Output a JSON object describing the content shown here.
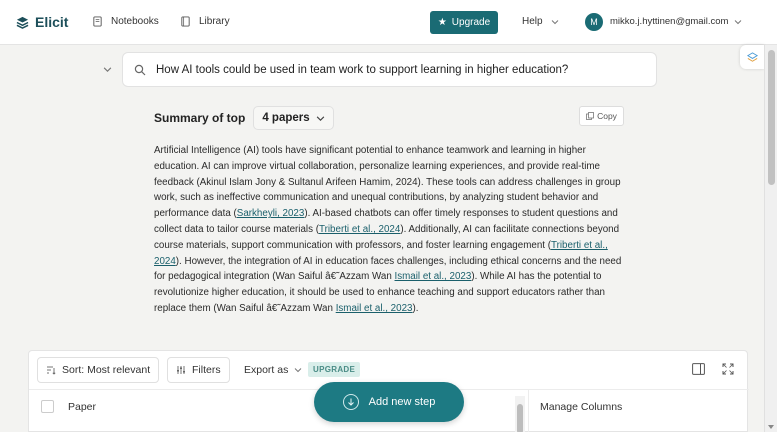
{
  "header": {
    "logo_text": "Elicit",
    "nav": [
      {
        "label": "Notebooks",
        "icon": "notebook-icon"
      },
      {
        "label": "Library",
        "icon": "library-icon"
      }
    ],
    "upgrade_label": "Upgrade",
    "help_label": "Help",
    "avatar_initial": "M",
    "email": "mikko.j.hyttinen@gmail.com"
  },
  "search": {
    "query": "How AI tools could be used in team work to support learning in higher education?"
  },
  "summary": {
    "label": "Summary of top",
    "papers_selected": "4 papers",
    "copy_label": "Copy",
    "segments": [
      {
        "text": "Artificial Intelligence (AI) tools have significant potential to enhance teamwork and learning in higher education. AI can improve virtual collaboration, personalize learning experiences, and provide real-time feedback (Akinul Islam Jony & Sultanul Arifeen Hamim, 2024). These tools can address challenges in group work, such as ineffective communication and unequal contributions, by analyzing student behavior and performance data ("
      },
      {
        "text": "Sarkheyli, 2023",
        "cite": true
      },
      {
        "text": "). AI-based chatbots can offer timely responses to student questions and collect data to tailor course materials ("
      },
      {
        "text": "Triberti et al., 2024",
        "cite": true
      },
      {
        "text": "). Additionally, AI can facilitate connections beyond course materials, support communication with professors, and foster learning engagement ("
      },
      {
        "text": "Triberti et al., 2024",
        "cite": true
      },
      {
        "text": "). However, the integration of AI in education faces challenges, including ethical concerns and the need for pedagogical integration (Wan Saiful â€˜Azzam Wan "
      },
      {
        "text": "Ismail et al., 2023",
        "cite": true
      },
      {
        "text": "). While AI has the potential to revolutionize higher education, it should be used to enhance teaching and support educators rather than replace them (Wan Saiful â€˜Azzam Wan "
      },
      {
        "text": "Ismail et al., 2023",
        "cite": true
      },
      {
        "text": ")."
      }
    ]
  },
  "table": {
    "sort_label": "Sort: Most relevant",
    "filters_label": "Filters",
    "export_label": "Export as",
    "upgrade_tag": "UPGRADE",
    "col_paper": "Paper",
    "manage_columns": "Manage Columns"
  },
  "add_step_label": "Add new step",
  "colors": {
    "accent": "#1a6b74",
    "cite": "#1a5f6b"
  }
}
